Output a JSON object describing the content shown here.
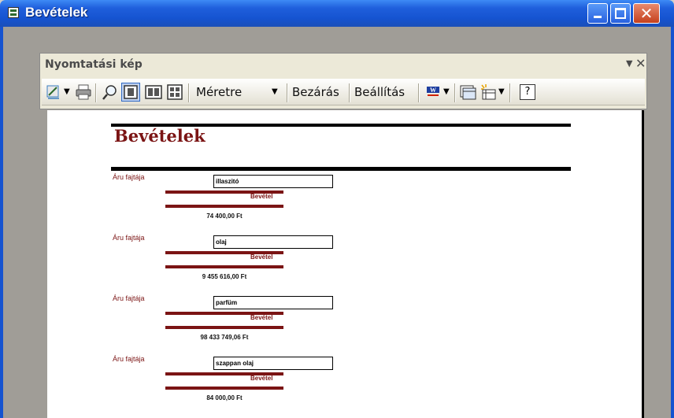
{
  "window": {
    "title": "Bevételek"
  },
  "panel": {
    "title": "Nyomtatási kép",
    "dropdown_icon": "▼",
    "close_icon": "✕"
  },
  "toolbar": {
    "zoom_value": "Méretre",
    "close_label": "Bezárás",
    "setup_label": "Beállítás",
    "help_icon": "?"
  },
  "report": {
    "title": "Bevételek",
    "records": [
      {
        "label": "Áru fajtája",
        "value": "illaszitó",
        "sub_label": "Bevétel",
        "amount": "74 400,00 Ft"
      },
      {
        "label": "Áru fajtája",
        "value": "olaj",
        "sub_label": "Bevétel",
        "amount": "9 455 616,00 Ft"
      },
      {
        "label": "Áru fajtája",
        "value": "parfüm",
        "sub_label": "Bevétel",
        "amount": "98 433 749,06 Ft"
      },
      {
        "label": "Áru fajtája",
        "value": "szappan olaj",
        "sub_label": "Bevétel",
        "amount": "84 000,00 Ft"
      }
    ]
  }
}
